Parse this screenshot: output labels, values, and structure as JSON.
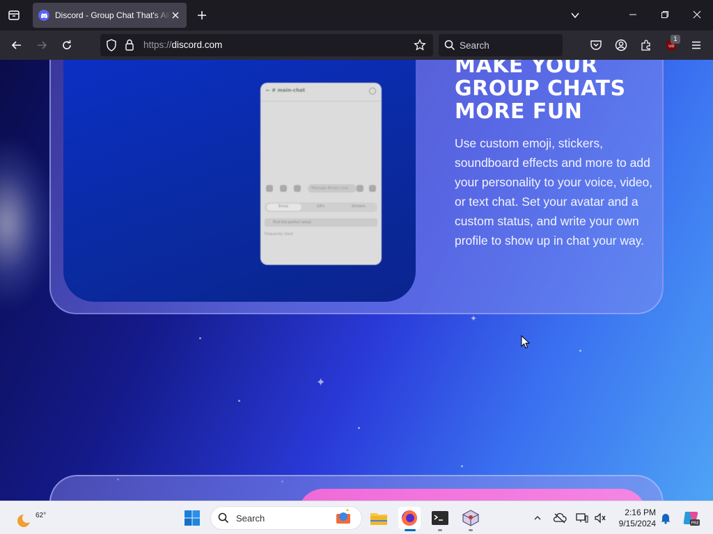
{
  "browser": {
    "tab_title": "Discord - Group Chat That's All Fun & Games",
    "url_scheme": "https://",
    "url_host": "discord.com",
    "search_placeholder": "Search",
    "extension_badge": "1"
  },
  "page": {
    "headline_lines": [
      "MAKE YOUR",
      "GROUP CHATS",
      "MORE FUN"
    ],
    "body": "Use custom emoji, stickers, soundboard effects and more to add your personality to your voice, video, or text chat. Set your avatar and a custom status, and write your own profile to show up in chat your way.",
    "phone": {
      "channel": "main-chat",
      "input_placeholder": "Message #main-chat",
      "tabs": [
        "Emoji",
        "GIFs",
        "Stickers"
      ],
      "search_hint": "Find the perfect emoji",
      "section_label": "Frequently Used"
    }
  },
  "taskbar": {
    "temperature": "62°",
    "search_placeholder": "Search",
    "time": "2:16 PM",
    "date": "9/15/2024"
  },
  "colors": {
    "accent_discord": "#5865f2",
    "page_gradient_dark": "#0a0c4a",
    "page_gradient_light": "#4ea4f5",
    "pink_panel": "#f06ad8"
  }
}
